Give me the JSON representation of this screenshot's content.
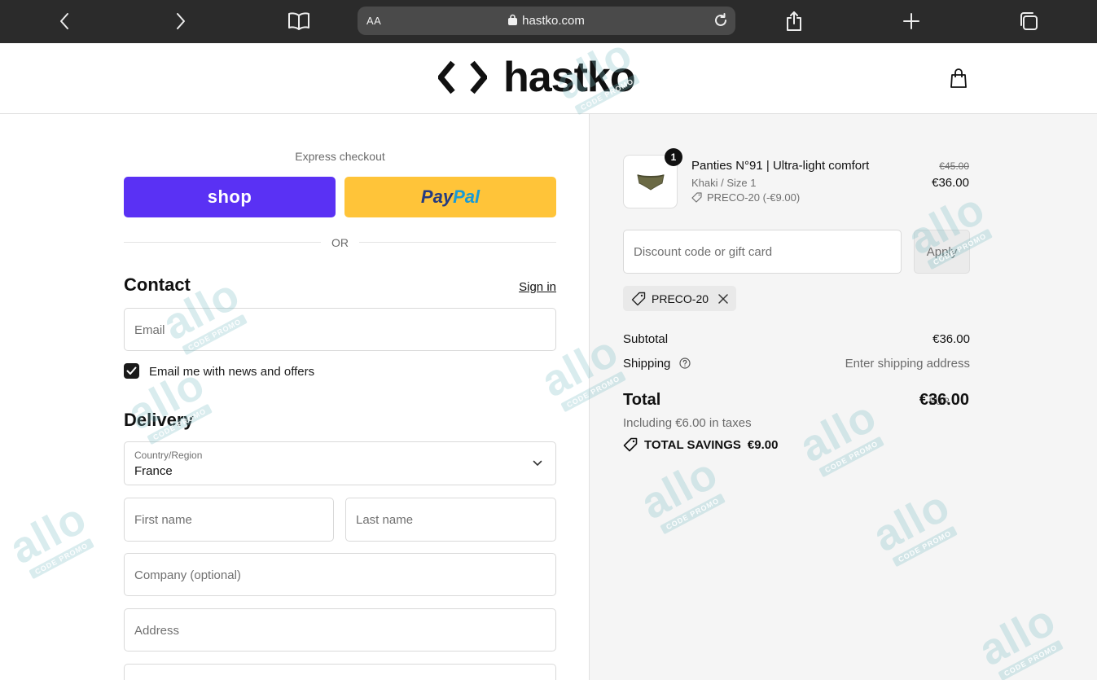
{
  "browser": {
    "text_size": "AA",
    "url": "hastko.com",
    "icons": [
      "back-icon",
      "forward-icon",
      "bookmarks-icon",
      "lock-icon",
      "reload-icon",
      "share-icon",
      "new-tab-icon",
      "tabs-icon"
    ]
  },
  "header": {
    "brand": "hastko"
  },
  "express": {
    "title": "Express checkout",
    "shop_label": "shop",
    "paypal_pay": "Pay",
    "paypal_pal": "Pal",
    "or": "OR"
  },
  "contact": {
    "title": "Contact",
    "sign_in": "Sign in",
    "email_placeholder": "Email",
    "newsletter_label": "Email me with news and offers",
    "newsletter_checked": true
  },
  "delivery": {
    "title": "Delivery",
    "country_label": "Country/Region",
    "country_value": "France",
    "first_name_placeholder": "First name",
    "last_name_placeholder": "Last name",
    "company_placeholder": "Company (optional)",
    "address_placeholder": "Address"
  },
  "summary": {
    "item": {
      "quantity": "1",
      "name": "Panties N°91 | Ultra-light comfort",
      "variant": "Khaki / Size 1",
      "discount": "PRECO-20 (-€9.00)",
      "old_price": "€45.00",
      "price": "€36.00"
    },
    "discount_placeholder": "Discount code or gift card",
    "apply_label": "Apply",
    "applied_code": "PRECO-20",
    "subtotal_label": "Subtotal",
    "subtotal_value": "€36.00",
    "shipping_label": "Shipping",
    "shipping_value": "Enter shipping address",
    "total_label": "Total",
    "currency": "EUR",
    "total_value": "€36.00",
    "taxes": "Including €6.00 in taxes",
    "savings_label": "TOTAL SAVINGS",
    "savings_value": "€9.00"
  },
  "watermark": {
    "text": "allo",
    "subtext": "CODE PROMO"
  }
}
